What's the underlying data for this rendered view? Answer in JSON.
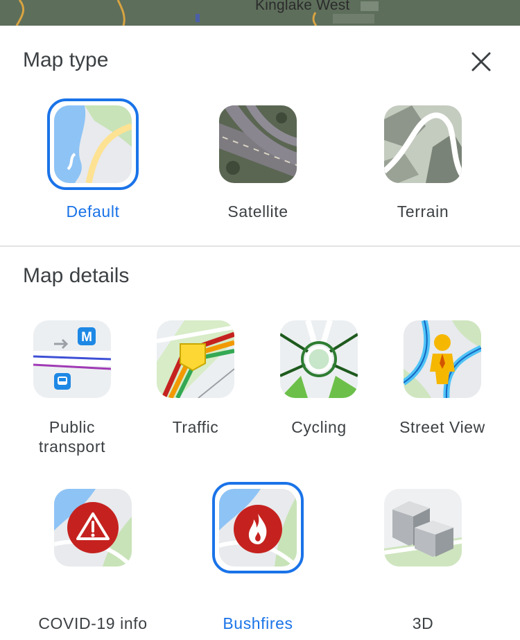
{
  "map_preview": {
    "place_label": "Kinglake West"
  },
  "sheet": {
    "map_type": {
      "title": "Map type",
      "options": [
        {
          "label": "Default",
          "icon": "default-map-icon",
          "selected": true
        },
        {
          "label": "Satellite",
          "icon": "satellite-map-icon",
          "selected": false
        },
        {
          "label": "Terrain",
          "icon": "terrain-map-icon",
          "selected": false
        }
      ]
    },
    "map_details": {
      "title": "Map details",
      "options": [
        {
          "label": "Public transport",
          "line1": "Public",
          "line2": "transport",
          "icon": "public-transport-icon",
          "selected": false
        },
        {
          "label": "Traffic",
          "icon": "traffic-icon",
          "selected": false
        },
        {
          "label": "Cycling",
          "icon": "cycling-icon",
          "selected": false
        },
        {
          "label": "Street View",
          "icon": "street-view-pegman-icon",
          "selected": false
        },
        {
          "label": "COVID-19 info",
          "icon": "covid-warning-icon",
          "selected": false
        },
        {
          "label": "Bushfires",
          "icon": "bushfire-flame-icon",
          "selected": true
        },
        {
          "label": "3D",
          "icon": "3d-buildings-icon",
          "selected": false
        }
      ]
    },
    "close_icon": "close-icon"
  },
  "colors": {
    "accent": "#1a73e8",
    "text": "#3c4043",
    "alert_red": "#d32f2f"
  }
}
